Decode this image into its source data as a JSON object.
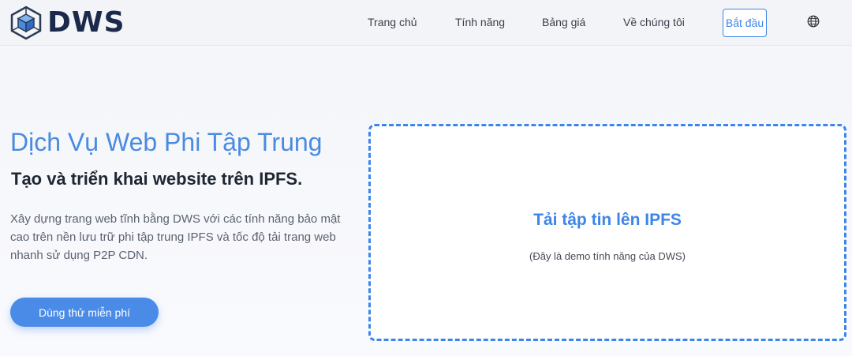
{
  "brand": {
    "name": "DWS",
    "logo_icon": "cube-icon"
  },
  "nav": {
    "items": [
      {
        "label": "Trang chủ"
      },
      {
        "label": "Tính năng"
      },
      {
        "label": "Bảng giá"
      },
      {
        "label": "Về chúng tôi"
      }
    ],
    "cta_label": "Bắt đầu",
    "language_icon": "globe-icon"
  },
  "hero": {
    "title": "Dịch Vụ Web Phi Tập Trung",
    "subtitle": "Tạo và triển khai website trên IPFS.",
    "description": "Xây dựng trang web tĩnh bằng DWS với các tính năng bảo mật cao trên nền lưu trữ phi tập trung IPFS và tốc độ tải trang web nhanh sử dụng P2P CDN.",
    "trial_button": "Dùng thử miễn phí"
  },
  "upload": {
    "title": "Tải tập tin lên IPFS",
    "note": "(Đây là demo tính năng của DWS)"
  },
  "colors": {
    "accent": "#3d86e8",
    "brand_dark": "#1b2a4a",
    "title_blue": "#4a8be0"
  }
}
